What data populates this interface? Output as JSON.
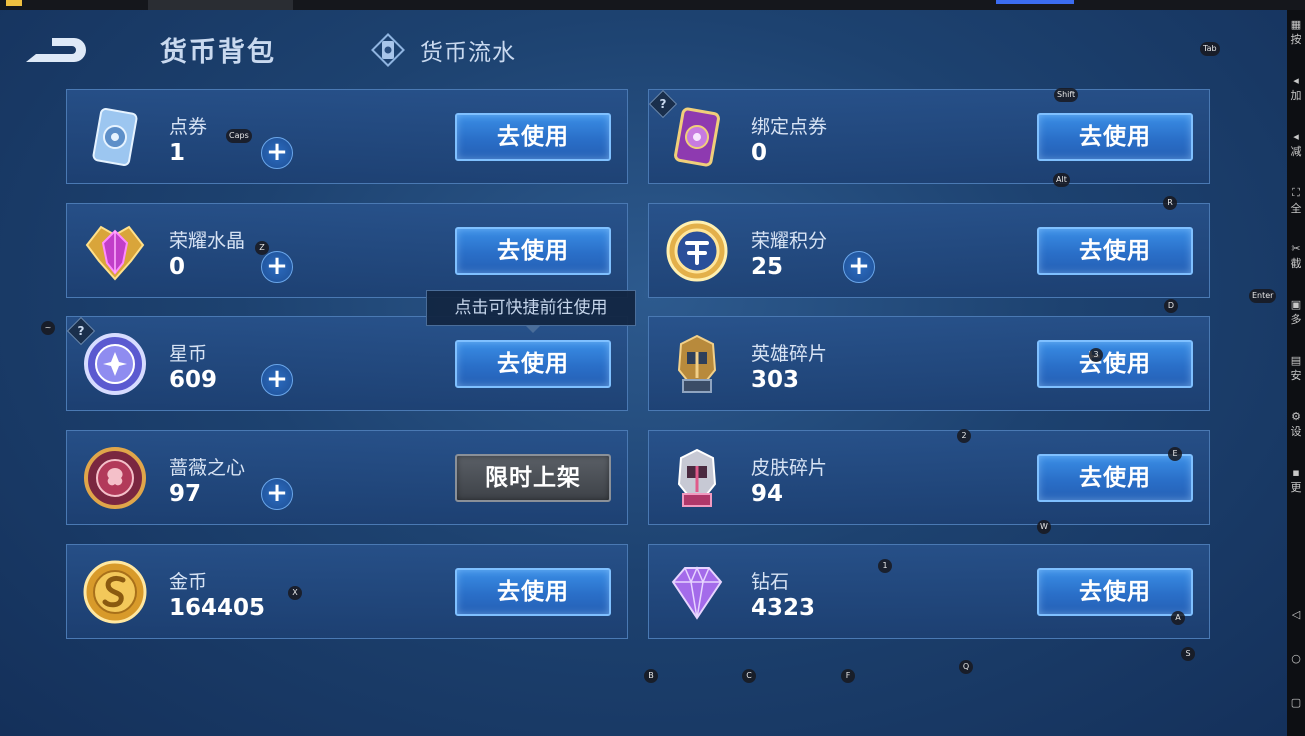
{
  "header": {
    "title": "货币背包",
    "tab_flow": "货币流水"
  },
  "currencies_left": [
    {
      "name": "点券",
      "value": "1",
      "button": "去使用",
      "plus": "+"
    },
    {
      "name": "荣耀水晶",
      "value": "0",
      "button": "去使用"
    },
    {
      "name": "星币",
      "value": "609",
      "button": "去使用",
      "plus": "+",
      "help": "?"
    },
    {
      "name": "蔷薇之心",
      "value": "97",
      "button": "限时上架",
      "plus": "+"
    },
    {
      "name": "金币",
      "value": "164405",
      "button": "去使用"
    }
  ],
  "currencies_right": [
    {
      "name": "绑定点券",
      "value": "0",
      "button": "去使用",
      "help": "?"
    },
    {
      "name": "荣耀积分",
      "value": "25",
      "button": "去使用",
      "plus": "+"
    },
    {
      "name": "英雄碎片",
      "value": "303",
      "button": "去使用"
    },
    {
      "name": "皮肤碎片",
      "value": "94",
      "button": "去使用"
    },
    {
      "name": "钻石",
      "value": "4323",
      "button": "去使用"
    }
  ],
  "plus_extra": "+",
  "tooltip": "点击可快捷前往使用",
  "key_hints": [
    "Tab",
    "Shift",
    "Caps",
    "Alt",
    "R",
    "Z",
    "Enter",
    "D",
    "~",
    "3",
    "2",
    "E",
    "W",
    "1",
    "X",
    "A",
    "S",
    "Q",
    "B",
    "C",
    "F"
  ],
  "sidebar_labels": [
    "按",
    "加",
    "减",
    "全",
    "截",
    "多",
    "安",
    "设",
    "更"
  ],
  "colors": {
    "background": "#1d4270",
    "card": "#284f8a",
    "button_blue": "#2a6fc8",
    "button_gray": "#4a4e55"
  }
}
